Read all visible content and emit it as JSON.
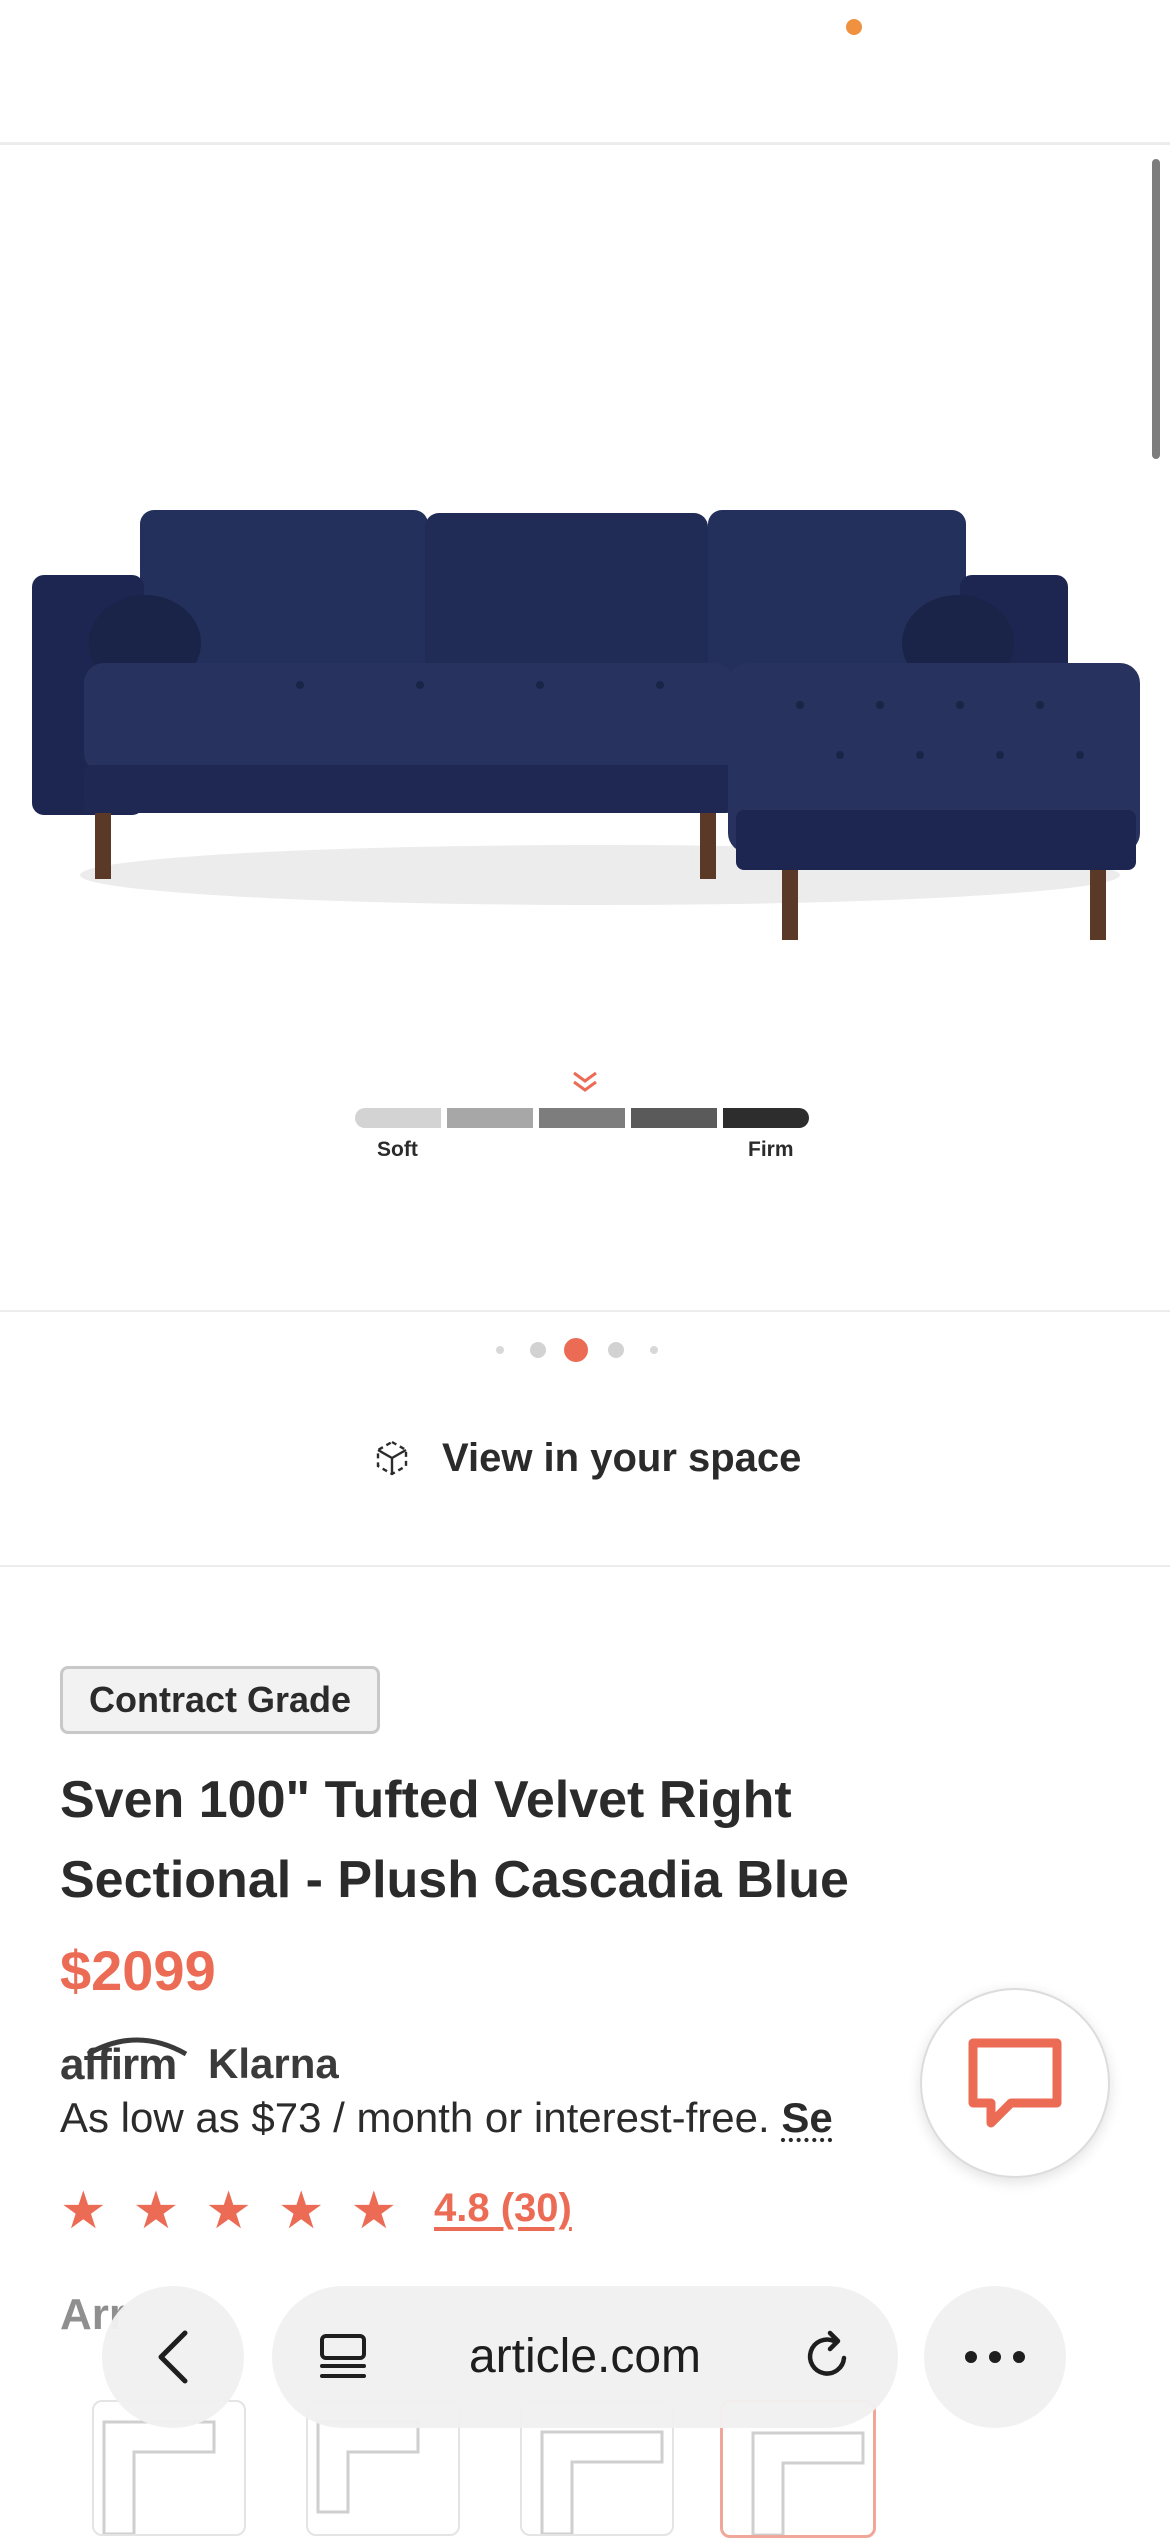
{
  "product": {
    "badge": "Contract Grade",
    "title": "Sven 100\" Tufted Velvet Right Sectional - Plush Cascadia Blue",
    "price": "$2099",
    "rating": "4.8 (30)",
    "stars": 5
  },
  "gallery": {
    "firmness_low": "Soft",
    "firmness_high": "Firm",
    "ar_label": "View in your space",
    "slide_count": 5,
    "active_slide": 3
  },
  "financing": {
    "affirm_logo": "affirm",
    "klarna_logo": "Klarna",
    "text": "As low as $73 / month or interest-free.",
    "link": "Se"
  },
  "arrangement_label": "Arr",
  "browser": {
    "url": "article.com"
  },
  "colors": {
    "accent": "#ec6b55",
    "notification": "#f0913f",
    "sofa": "#1f2a52"
  }
}
